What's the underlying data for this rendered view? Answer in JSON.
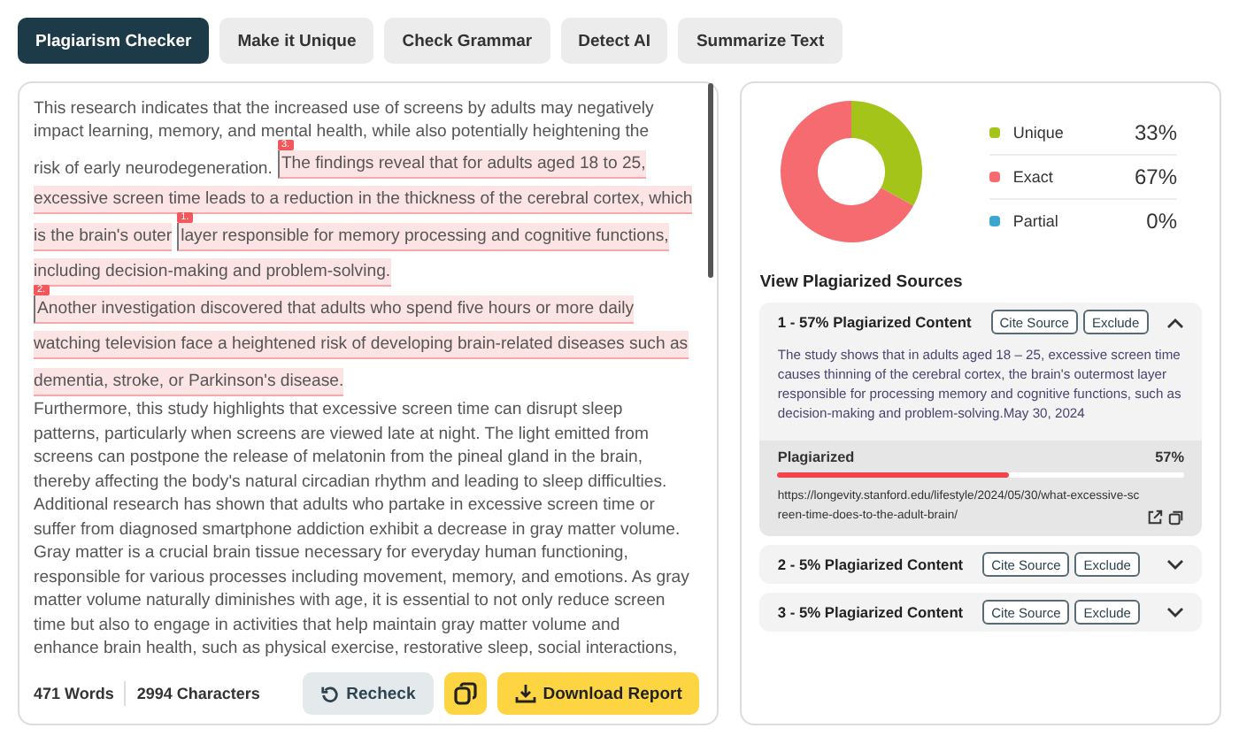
{
  "tabs": [
    {
      "label": "Plagiarism Checker",
      "selected": true
    },
    {
      "label": "Make it Unique",
      "selected": false
    },
    {
      "label": "Check Grammar",
      "selected": false
    },
    {
      "label": "Detect AI",
      "selected": false
    },
    {
      "label": "Summarize Text",
      "selected": false
    }
  ],
  "editor": {
    "lines": [
      [
        {
          "text": "This research indicates that the increased use of screens by adults may negatively",
          "highlighted": false
        }
      ],
      [
        {
          "text": "impact learning, memory, and mental health, while also potentially heightening the",
          "highlighted": false
        }
      ],
      [
        {
          "text": "risk of early neurodegeneration.",
          "highlighted": false
        },
        {
          "text": "The findings reveal that for adults aged 18 to 25,",
          "highlighted": true,
          "marker": "3."
        }
      ],
      [
        {
          "text": "excessive screen time leads to a reduction in the thickness of the cerebral cortex, which",
          "highlighted": true
        }
      ],
      [
        {
          "text": "is the brain's outer",
          "highlighted": true
        },
        {
          "text": "layer responsible for memory processing and cognitive functions,",
          "highlighted": true,
          "marker": "1."
        }
      ],
      [
        {
          "text": "including decision-making and problem-solving.",
          "highlighted": true
        }
      ],
      [
        {
          "text": "Another investigation discovered that adults who spend five hours or more daily",
          "highlighted": true,
          "marker": "2."
        }
      ],
      [
        {
          "text": "watching television face a heightened risk of developing brain-related diseases such as",
          "highlighted": true
        }
      ],
      [
        {
          "text": "dementia, stroke, or Parkinson's disease.",
          "highlighted": true
        }
      ],
      [
        {
          "text": "Furthermore, this study highlights that excessive screen time can disrupt sleep",
          "highlighted": false
        }
      ],
      [
        {
          "text": "patterns, particularly when screens are viewed late at night. The light emitted from",
          "highlighted": false
        }
      ],
      [
        {
          "text": "screens can postpone the release of melatonin from the pineal gland in the brain,",
          "highlighted": false
        }
      ],
      [
        {
          "text": "thereby affecting the body's natural circadian rhythm and leading to sleep difficulties.",
          "highlighted": false
        }
      ],
      [
        {
          "text": "Additional research has shown that adults who partake in excessive screen time or",
          "highlighted": false
        }
      ],
      [
        {
          "text": "suffer from diagnosed smartphone addiction exhibit a decrease in gray matter volume.",
          "highlighted": false
        }
      ],
      [
        {
          "text": "Gray matter is a crucial brain tissue necessary for everyday human functioning,",
          "highlighted": false
        }
      ],
      [
        {
          "text": "responsible for various processes including movement, memory, and emotions. As gray",
          "highlighted": false
        }
      ],
      [
        {
          "text": "matter volume naturally diminishes with age, it is essential to not only reduce screen",
          "highlighted": false
        }
      ],
      [
        {
          "text": "time but also to engage in activities that help maintain gray matter volume and",
          "highlighted": false
        }
      ],
      [
        {
          "text": "enhance brain health, such as physical exercise, restorative sleep, social interactions,",
          "highlighted": false
        }
      ]
    ],
    "word_count": "471 Words",
    "char_count": "2994 Characters",
    "buttons": [
      {
        "kind": "recheck",
        "label": "Recheck"
      },
      {
        "kind": "copy"
      },
      {
        "kind": "download",
        "label": "Download Report"
      }
    ]
  },
  "summary": {
    "chart_data": {
      "type": "donut",
      "categories": [
        "Unique",
        "Exact",
        "Partial"
      ],
      "values": [
        33,
        67,
        0
      ]
    },
    "legend": [
      {
        "value": "33%",
        "color": "#a4c41a"
      },
      {
        "value": "67%",
        "color": "#f56b6f"
      },
      {
        "value": "0%",
        "color": "#3aa7d0"
      }
    ]
  },
  "sources_title": "View Plagiarized Sources",
  "sources": [
    {
      "title": "1 - 57% Plagiarized Content",
      "cite": "Cite Source",
      "exclude": "Exclude",
      "expanded": true,
      "excerpt": "The study shows that in adults aged 18 – 25, excessive screen time causes thinning of the cerebral cortex, the brain's outermost layer responsible for processing memory and cognitive functions, such as decision-making and problem-solving.May 30, 2024",
      "meter_label": "Plagiarized",
      "reading": "57%",
      "level": 0.57,
      "url": "https://longevity.stanford.edu/lifestyle/2024/05/30/what-excessive-screen-time-does-to-the-adult-brain/"
    },
    {
      "title": "2 - 5% Plagiarized Content",
      "cite": "Cite Source",
      "exclude": "Exclude",
      "expanded": false
    },
    {
      "title": "3 - 5% Plagiarized Content",
      "cite": "Cite Source",
      "exclude": "Exclude",
      "expanded": false
    }
  ]
}
